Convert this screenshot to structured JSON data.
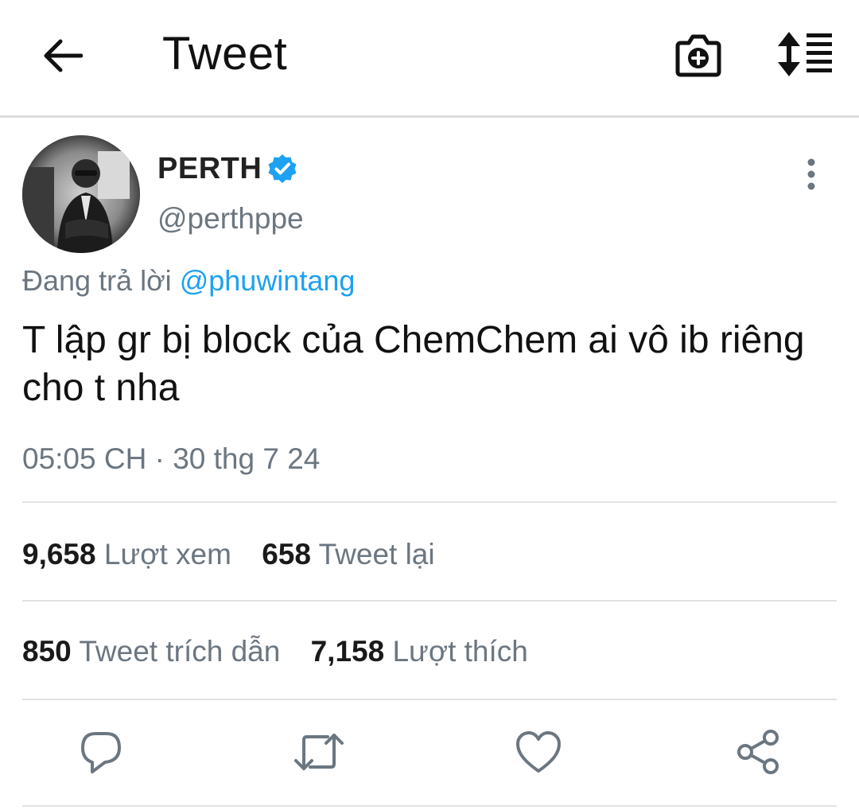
{
  "header": {
    "title": "Tweet",
    "back_icon": "back-arrow-icon",
    "camera_icon": "camera-add-icon",
    "sort_icon": "sort-list-icon"
  },
  "author": {
    "display_name": "PERTH",
    "handle": "@perthppe",
    "verified": true,
    "verified_color": "#1da1f2"
  },
  "reply": {
    "prefix": "Đang trả lời",
    "mention": "@phuwintang",
    "mention_color": "#1da1f2"
  },
  "tweet": {
    "text": "T lập gr bị block của ChemChem ai vô ib riêng cho t nha",
    "timestamp": "05:05 CH · 30 thg 7 24"
  },
  "stats": {
    "views_count": "9,658",
    "views_label": "Lượt xem",
    "retweets_count": "658",
    "retweets_label": "Tweet lại",
    "quotes_count": "850",
    "quotes_label": "Tweet trích dẫn",
    "likes_count": "7,158",
    "likes_label": "Lượt thích"
  },
  "actions": [
    {
      "icon": "reply-icon"
    },
    {
      "icon": "retweet-icon"
    },
    {
      "icon": "like-icon"
    },
    {
      "icon": "share-icon"
    }
  ]
}
